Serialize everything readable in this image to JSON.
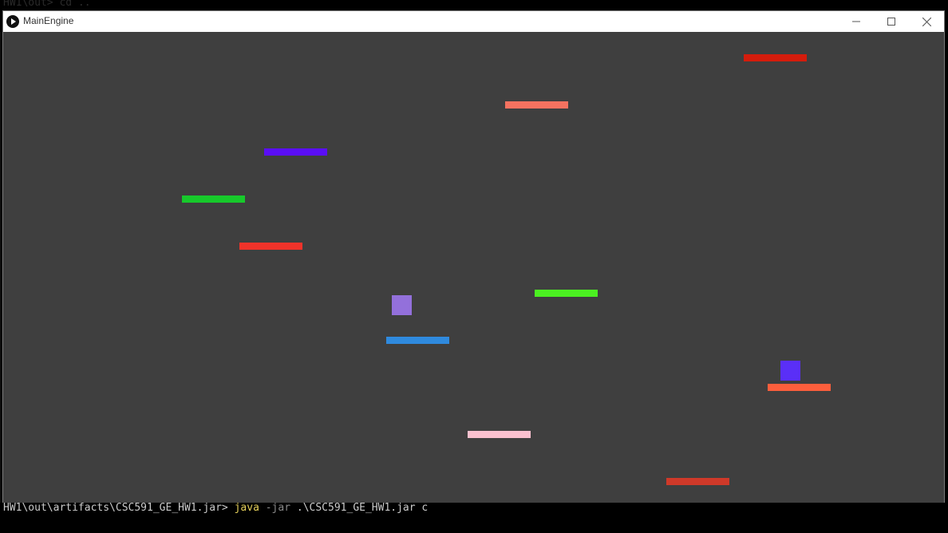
{
  "terminal": {
    "top_line": "HW1\\out> cd ..",
    "prompt": "HW1\\out\\artifacts\\CSC591_GE_HW1.jar>",
    "command": "java",
    "flag": "-jar",
    "args": ".\\CSC591_GE_HW1.jar c"
  },
  "window": {
    "title": "MainEngine",
    "icons": {
      "app": "play-icon",
      "minimize": "minimize-icon",
      "maximize": "maximize-icon",
      "close": "close-icon"
    }
  },
  "game": {
    "background": "#3f3f3f",
    "platform_colors": [
      "#d41c0c",
      "#f47260",
      "#5a0ef7",
      "#17c92b",
      "#f0332a",
      "#4bf021",
      "#2f8ade",
      "#fc5e3c",
      "#fac1cf",
      "#cf3929"
    ],
    "player_colors": [
      "#9370db",
      "#5a2ff7"
    ]
  }
}
